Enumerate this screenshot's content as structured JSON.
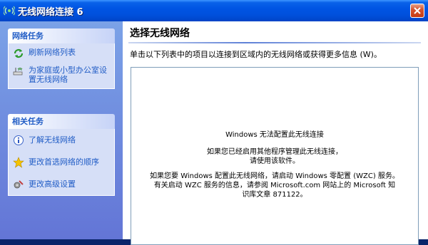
{
  "window": {
    "title": "无线网络连接 6",
    "title_icon": "wireless-network-icon",
    "close_icon": "close-icon"
  },
  "sidebar": {
    "network_tasks": {
      "header": "网络任务",
      "items": [
        {
          "label": "刷新网络列表",
          "icon": "refresh-icon"
        },
        {
          "label": "为家庭或小型办公室设置无线网络",
          "icon": "wireless-setup-icon"
        }
      ]
    },
    "related_tasks": {
      "header": "相关任务",
      "items": [
        {
          "label": "了解无线网络",
          "icon": "info-icon"
        },
        {
          "label": "更改首选网络的顺序",
          "icon": "star-icon"
        },
        {
          "label": "更改高级设置",
          "icon": "settings-icon"
        }
      ]
    }
  },
  "main": {
    "heading": "选择无线网络",
    "instruction": "单击以下列表中的项目以连接到区域内的无线网络或获得更多信息 (W)。",
    "message": {
      "line1": "Windows 无法配置此无线连接",
      "line2": "如果您已经启用其他程序管理此无线连接，",
      "line3": "请使用该软件。",
      "line4": "如果您要 Windows 配置此无线网络，请启动 Windows 零配置 (WZC) 服务。",
      "line5": "有关启动 WZC 服务的信息，请参阅 Microsoft.com 网站上的 Microsoft 知",
      "line6": "识库文章 871122。"
    }
  },
  "colors": {
    "titlebar": "#0054e3",
    "sidebar": "#6f8ee0",
    "panel_body": "#d6dff7",
    "link": "#215dc6",
    "close": "#c33a13"
  }
}
